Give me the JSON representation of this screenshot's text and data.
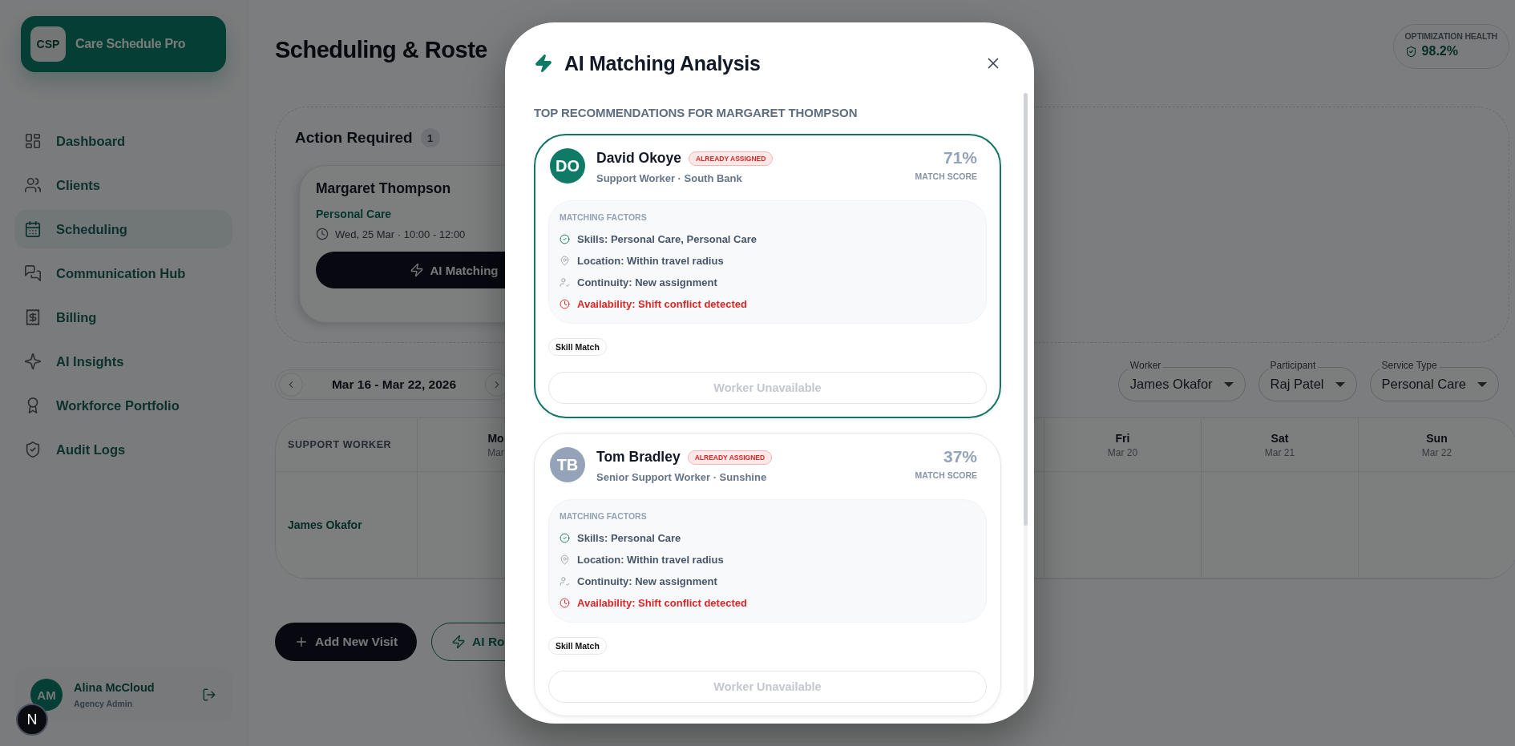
{
  "sidebar": {
    "logo": {
      "mark": "CSP",
      "name": "Care Schedule Pro"
    },
    "items": [
      {
        "label": "Dashboard",
        "kind": "grid",
        "selected": false
      },
      {
        "label": "Clients",
        "kind": "users",
        "selected": false
      },
      {
        "label": "Scheduling",
        "kind": "calendar",
        "selected": true
      },
      {
        "label": "Communication Hub",
        "kind": "chat",
        "selected": false
      },
      {
        "label": "Billing",
        "kind": "receipt",
        "selected": false
      },
      {
        "label": "AI Insights",
        "kind": "sparkles",
        "selected": false
      },
      {
        "label": "Workforce Portfolio",
        "kind": "award",
        "selected": false
      },
      {
        "label": "Audit Logs",
        "kind": "shield",
        "selected": false
      }
    ],
    "user": {
      "initials": "AM",
      "name": "Alina McCloud",
      "role": "Agency Admin"
    }
  },
  "dev_badge": "N",
  "header": {
    "title": "Scheduling & Roste",
    "health": {
      "label": "OPTIMIZATION HEALTH",
      "value": "98.2%"
    }
  },
  "action_required": {
    "title": "Action Required",
    "count": "1",
    "cards": [
      {
        "client": "Margaret Thompson",
        "service": "Personal Care",
        "time": "Wed, 25 Mar · 10:00 - 12:00",
        "button": "AI Matching"
      }
    ]
  },
  "week_nav": {
    "label": "Mar 16 - Mar 22, 2026"
  },
  "filters": [
    {
      "label": "Worker",
      "value": "James Okafor"
    },
    {
      "label": "Participant",
      "value": "Raj Patel"
    },
    {
      "label": "Service Type",
      "value": "Personal Care"
    }
  ],
  "calendar": {
    "corner": "SUPPORT WORKER",
    "days": [
      {
        "day": "Mo",
        "date": "Mar"
      },
      {
        "day": "Fri",
        "date": "Mar 20"
      },
      {
        "day": "Sat",
        "date": "Mar 21"
      },
      {
        "day": "Sun",
        "date": "Mar 22"
      }
    ],
    "rows": [
      {
        "worker": "James Okafor"
      }
    ]
  },
  "actions": [
    {
      "kind": "primary",
      "label": "Add New Visit"
    },
    {
      "kind": "outline",
      "label": "AI Ro"
    }
  ],
  "modal": {
    "title": "AI Matching Analysis",
    "subtitle": "TOP RECOMMENDATIONS FOR MARGARET THOMPSON",
    "candidates": [
      {
        "initials": "DO",
        "color": "#0f7a66",
        "name": "David Okoye",
        "badge": "ALREADY ASSIGNED",
        "role": "Support Worker · South Bank",
        "score": "71%",
        "score_label": "MATCH SCORE",
        "selected": true,
        "factors_title": "MATCHING FACTORS",
        "factors": [
          {
            "kind": "skills",
            "text": "Skills: Personal Care, Personal Care",
            "warning": false
          },
          {
            "kind": "location",
            "text": "Location: Within travel radius",
            "warning": false
          },
          {
            "kind": "continuity",
            "text": "Continuity: New assignment",
            "warning": false
          },
          {
            "kind": "availability",
            "text": "Availability: Shift conflict detected",
            "warning": true
          }
        ],
        "tags": [
          "Skill Match"
        ],
        "action": {
          "label": "Worker Unavailable",
          "disabled": true
        }
      },
      {
        "initials": "TB",
        "color": "#94a3b8",
        "name": "Tom Bradley",
        "badge": "ALREADY ASSIGNED",
        "role": "Senior Support Worker · Sunshine",
        "score": "37%",
        "score_label": "MATCH SCORE",
        "selected": false,
        "factors_title": "MATCHING FACTORS",
        "factors": [
          {
            "kind": "skills",
            "text": "Skills: Personal Care",
            "warning": false
          },
          {
            "kind": "location",
            "text": "Location: Within travel radius",
            "warning": false
          },
          {
            "kind": "continuity",
            "text": "Continuity: New assignment",
            "warning": false
          },
          {
            "kind": "availability",
            "text": "Availability: Shift conflict detected",
            "warning": true
          }
        ],
        "tags": [
          "Skill Match"
        ],
        "action": {
          "label": "Worker Unavailable",
          "disabled": true
        }
      }
    ]
  }
}
